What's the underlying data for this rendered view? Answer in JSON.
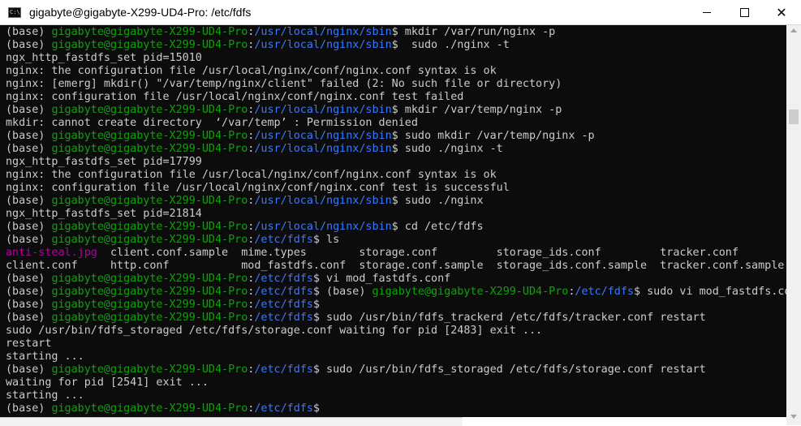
{
  "window": {
    "title": "gigabyte@gigabyte-X299-UD4-Pro: /etc/fdfs",
    "icon": "terminal-icon",
    "icon_text": "C:\\"
  },
  "colors": {
    "background": "#0c0c0c",
    "text": "#cccccc",
    "user_host": "#13a10e",
    "path": "#3b78ff",
    "image_file": "#b4009e"
  },
  "terminal": {
    "lines": [
      [
        {
          "t": "(base) "
        },
        {
          "t": "gigabyte@gigabyte-X299-UD4-Pro",
          "c": "g"
        },
        {
          "t": ":"
        },
        {
          "t": "/usr/local/nginx/sbin",
          "c": "b"
        },
        {
          "t": "$ mkdir /var/run/nginx -p"
        }
      ],
      [
        {
          "t": "(base) "
        },
        {
          "t": "gigabyte@gigabyte-X299-UD4-Pro",
          "c": "g"
        },
        {
          "t": ":"
        },
        {
          "t": "/usr/local/nginx/sbin",
          "c": "b"
        },
        {
          "t": "$  sudo ./nginx -t"
        }
      ],
      [
        {
          "t": "ngx_http_fastdfs_set pid=15010"
        }
      ],
      [
        {
          "t": "nginx: the configuration file /usr/local/nginx/conf/nginx.conf syntax is ok"
        }
      ],
      [
        {
          "t": "nginx: [emerg] mkdir() \"/var/temp/nginx/client\" failed (2: No such file or directory)"
        }
      ],
      [
        {
          "t": "nginx: configuration file /usr/local/nginx/conf/nginx.conf test failed"
        }
      ],
      [
        {
          "t": "(base) "
        },
        {
          "t": "gigabyte@gigabyte-X299-UD4-Pro",
          "c": "g"
        },
        {
          "t": ":"
        },
        {
          "t": "/usr/local/nginx/sbin",
          "c": "b"
        },
        {
          "t": "$ mkdir /var/temp/nginx -p"
        }
      ],
      [
        {
          "t": "mkdir: cannot create directory  ‘/var/temp’ : Permission denied"
        }
      ],
      [
        {
          "t": "(base) "
        },
        {
          "t": "gigabyte@gigabyte-X299-UD4-Pro",
          "c": "g"
        },
        {
          "t": ":"
        },
        {
          "t": "/usr/local/nginx/sbin",
          "c": "b"
        },
        {
          "t": "$ sudo mkdir /var/temp/nginx -p"
        }
      ],
      [
        {
          "t": "(base) "
        },
        {
          "t": "gigabyte@gigabyte-X299-UD4-Pro",
          "c": "g"
        },
        {
          "t": ":"
        },
        {
          "t": "/usr/local/nginx/sbin",
          "c": "b"
        },
        {
          "t": "$ sudo ./nginx -t"
        }
      ],
      [
        {
          "t": "ngx_http_fastdfs_set pid=17799"
        }
      ],
      [
        {
          "t": "nginx: the configuration file /usr/local/nginx/conf/nginx.conf syntax is ok"
        }
      ],
      [
        {
          "t": "nginx: configuration file /usr/local/nginx/conf/nginx.conf test is successful"
        }
      ],
      [
        {
          "t": "(base) "
        },
        {
          "t": "gigabyte@gigabyte-X299-UD4-Pro",
          "c": "g"
        },
        {
          "t": ":"
        },
        {
          "t": "/usr/local/nginx/sbin",
          "c": "b"
        },
        {
          "t": "$ sudo ./nginx"
        }
      ],
      [
        {
          "t": "ngx_http_fastdfs_set pid=21814"
        }
      ],
      [
        {
          "t": "(base) "
        },
        {
          "t": "gigabyte@gigabyte-X299-UD4-Pro",
          "c": "g"
        },
        {
          "t": ":"
        },
        {
          "t": "/usr/local/nginx/sbin",
          "c": "b"
        },
        {
          "t": "$ cd /etc/fdfs"
        }
      ],
      [
        {
          "t": "(base) "
        },
        {
          "t": "gigabyte@gigabyte-X299-UD4-Pro",
          "c": "g"
        },
        {
          "t": ":"
        },
        {
          "t": "/etc/fdfs",
          "c": "b"
        },
        {
          "t": "$ ls"
        }
      ],
      [
        {
          "t": "anti-steal.jpg",
          "c": "m"
        },
        {
          "t": "  client.conf.sample  mime.types        storage.conf         storage_ids.conf         tracker.conf"
        }
      ],
      [
        {
          "t": "client.conf     http.conf           mod_fastdfs.conf  storage.conf.sample  storage_ids.conf.sample  tracker.conf.sample"
        }
      ],
      [
        {
          "t": "(base) "
        },
        {
          "t": "gigabyte@gigabyte-X299-UD4-Pro",
          "c": "g"
        },
        {
          "t": ":"
        },
        {
          "t": "/etc/fdfs",
          "c": "b"
        },
        {
          "t": "$ vi mod_fastdfs.conf"
        }
      ],
      [
        {
          "t": "(base) "
        },
        {
          "t": "gigabyte@gigabyte-X299-UD4-Pro",
          "c": "g"
        },
        {
          "t": ":"
        },
        {
          "t": "/etc/fdfs",
          "c": "b"
        },
        {
          "t": "$ (base) "
        },
        {
          "t": "gigabyte@gigabyte-X299-UD4-Pro",
          "c": "g"
        },
        {
          "t": ":"
        },
        {
          "t": "/etc/fdfs",
          "c": "b"
        },
        {
          "t": "$ sudo vi mod_fastdfs.co"
        }
      ],
      [
        {
          "t": "(base) "
        },
        {
          "t": "gigabyte@gigabyte-X299-UD4-Pro",
          "c": "g"
        },
        {
          "t": ":"
        },
        {
          "t": "/etc/fdfs",
          "c": "b"
        },
        {
          "t": "$"
        }
      ],
      [
        {
          "t": "(base) "
        },
        {
          "t": "gigabyte@gigabyte-X299-UD4-Pro",
          "c": "g"
        },
        {
          "t": ":"
        },
        {
          "t": "/etc/fdfs",
          "c": "b"
        },
        {
          "t": "$ sudo /usr/bin/fdfs_trackerd /etc/fdfs/tracker.conf restart"
        }
      ],
      [
        {
          "t": "sudo /usr/bin/fdfs_storaged /etc/fdfs/storage.conf waiting for pid [2483] exit ..."
        }
      ],
      [
        {
          "t": "restart"
        }
      ],
      [
        {
          "t": "starting ..."
        }
      ],
      [
        {
          "t": "(base) "
        },
        {
          "t": "gigabyte@gigabyte-X299-UD4-Pro",
          "c": "g"
        },
        {
          "t": ":"
        },
        {
          "t": "/etc/fdfs",
          "c": "b"
        },
        {
          "t": "$ sudo /usr/bin/fdfs_storaged /etc/fdfs/storage.conf restart"
        }
      ],
      [
        {
          "t": "waiting for pid [2541] exit ..."
        }
      ],
      [
        {
          "t": "starting ..."
        }
      ],
      [
        {
          "t": "(base) "
        },
        {
          "t": "gigabyte@gigabyte-X299-UD4-Pro",
          "c": "g"
        },
        {
          "t": ":"
        },
        {
          "t": "/etc/fdfs",
          "c": "b"
        },
        {
          "t": "$"
        }
      ]
    ]
  }
}
